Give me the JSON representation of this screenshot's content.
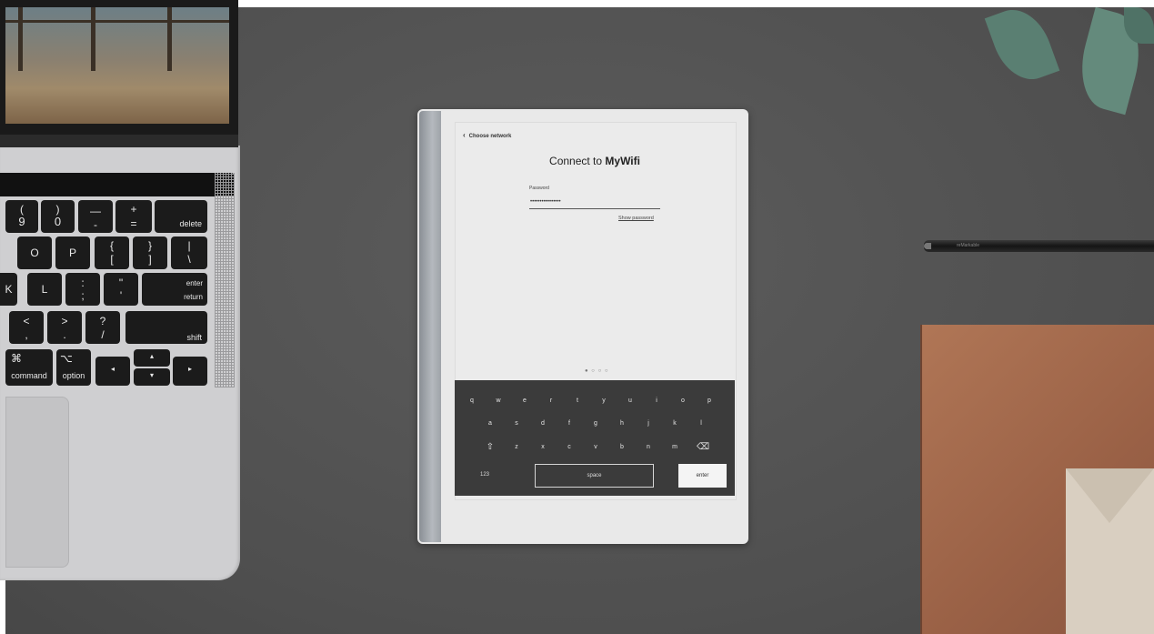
{
  "laptop": {
    "keys": {
      "row1": [
        {
          "top": "(",
          "bottom": "9"
        },
        {
          "top": ")",
          "bottom": "0"
        },
        {
          "top": "—",
          "bottom": "-"
        },
        {
          "top": "+",
          "bottom": "="
        },
        {
          "top": "",
          "bottom": "delete"
        }
      ],
      "row2": [
        {
          "top": "",
          "bottom": "O"
        },
        {
          "top": "",
          "bottom": "P"
        },
        {
          "top": "{",
          "bottom": "["
        },
        {
          "top": "}",
          "bottom": "]"
        },
        {
          "top": "|",
          "bottom": "\\"
        }
      ],
      "row3": [
        {
          "top": "",
          "bottom": "K"
        },
        {
          "top": "",
          "bottom": "L"
        },
        {
          "top": ":",
          "bottom": ";"
        },
        {
          "top": "\"",
          "bottom": "'"
        },
        {
          "top": "enter",
          "bottom": "return"
        }
      ],
      "row4": [
        {
          "top": "<",
          "bottom": ","
        },
        {
          "top": ">",
          "bottom": "."
        },
        {
          "top": "?",
          "bottom": "/"
        },
        {
          "top": "",
          "bottom": "shift"
        }
      ],
      "row5": [
        {
          "top": "⌘",
          "bottom": "command"
        },
        {
          "top": "⌥",
          "bottom": "option"
        },
        {
          "top": "",
          "bottom": "◂"
        },
        {
          "top": "▴",
          "bottom": "▾"
        },
        {
          "top": "",
          "bottom": "▸"
        }
      ]
    }
  },
  "tablet": {
    "back_label": "Choose network",
    "title_prefix": "Connect to ",
    "title_network": "MyWifi",
    "password_label": "Password",
    "password_value": "••••••••••••••••",
    "show_password": "Show password",
    "page_dots": "● ○ ○ ○",
    "keyboard": {
      "row1": [
        "q",
        "w",
        "e",
        "r",
        "t",
        "y",
        "u",
        "i",
        "o",
        "p"
      ],
      "row2": [
        "a",
        "s",
        "d",
        "f",
        "g",
        "h",
        "j",
        "k",
        "l"
      ],
      "row3": [
        "⇧",
        "z",
        "x",
        "c",
        "v",
        "b",
        "n",
        "m",
        "⌫"
      ],
      "num_key": "123",
      "space_key": "space",
      "enter_key": "enter"
    }
  },
  "pen": {
    "brand": "reMarkable"
  }
}
